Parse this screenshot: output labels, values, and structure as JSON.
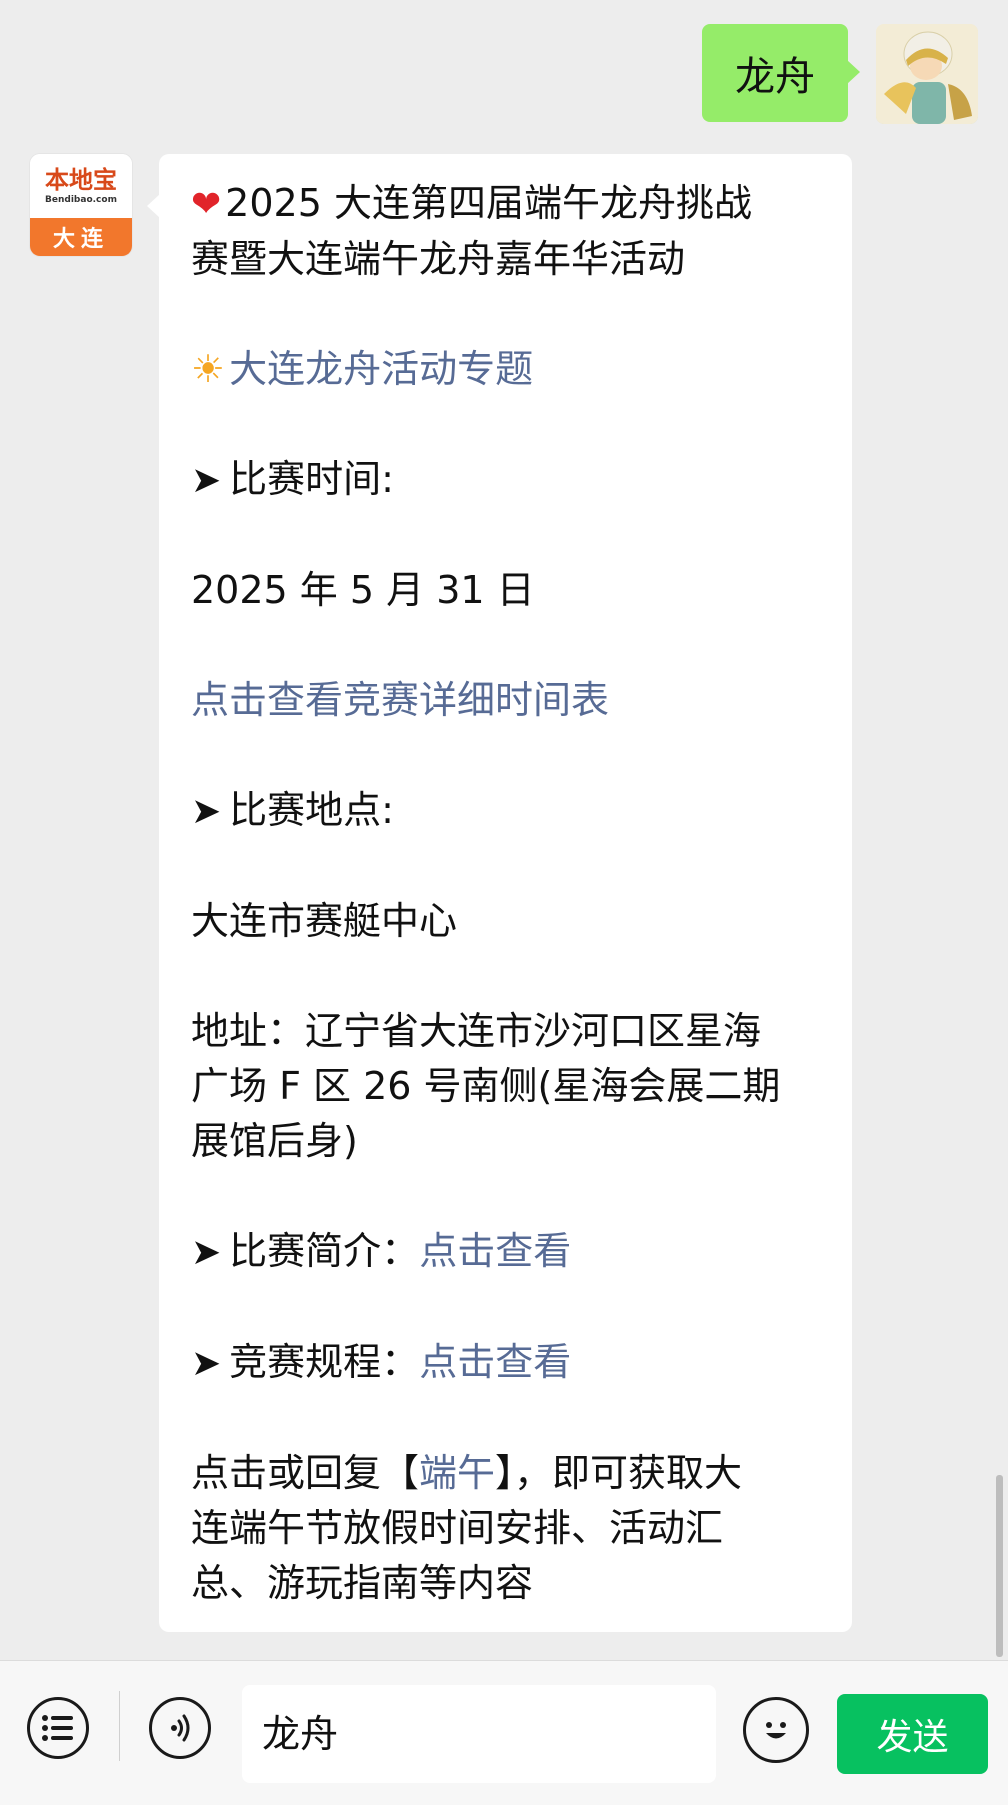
{
  "sent_message": {
    "text": "龙舟"
  },
  "bot_avatar": {
    "brand": "本地宝",
    "site": "Bendibao.com",
    "city": "大连"
  },
  "reply": {
    "title_line1": "2025 大连第四届端午龙舟挑战",
    "title_line2": "赛暨大连端午龙舟嘉年华活动",
    "topic_link": "大连龙舟活动专题",
    "time_heading": "比赛时间:",
    "time_value": "2025 年 5 月 31 日",
    "schedule_link": "点击查看竞赛详细时间表",
    "place_heading": "比赛地点:",
    "place_value": "大连市赛艇中心",
    "address_line1": "地址：辽宁省大连市沙河口区星海",
    "address_line2": "广场 F 区 26 号南侧(星海会展二期",
    "address_line3": "展馆后身)",
    "intro_heading": "比赛简介：",
    "intro_link": "点击查看",
    "rules_heading": "竞赛规程：",
    "rules_link": "点击查看",
    "footer_pre": "点击或回复【",
    "footer_keyword": "端午",
    "footer_post": "】，即可获取大",
    "footer_line2": "连端午节放假时间安排、活动汇",
    "footer_line3": "总、游玩指南等内容"
  },
  "input_bar": {
    "text": "龙舟",
    "send_label": "发送"
  },
  "colors": {
    "sent_bubble": "#95ec69",
    "link": "#576b95",
    "send_button": "#07c160"
  },
  "icons": [
    "list-icon",
    "voice-icon",
    "emoji-icon",
    "heart-icon",
    "sun-icon",
    "arrow-icon"
  ]
}
